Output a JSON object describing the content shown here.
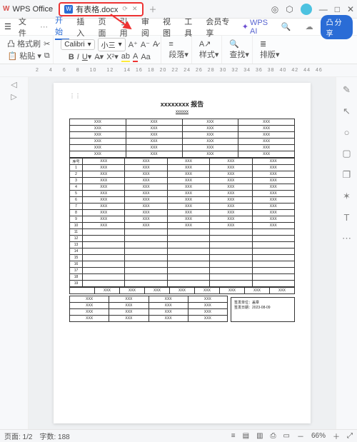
{
  "titlebar": {
    "app_name": "WPS Office",
    "tab_label": "有表格.docx",
    "plus": "＋"
  },
  "menubar": {
    "file_icon": "☰",
    "file": "文件",
    "items": [
      "开始",
      "插入",
      "页面",
      "引用",
      "审阅",
      "视图",
      "工具",
      "会员专享"
    ],
    "ai": "WPS AI",
    "share": "分享"
  },
  "toolbar": {
    "format_brush": "格式刷",
    "paste": "粘贴",
    "font_name": "Calibri",
    "font_size": "小三",
    "paragraph": "段落",
    "styles": "样式",
    "find": "查找",
    "layout": "排版"
  },
  "ruler_marks": [
    "2",
    "",
    "4",
    "",
    "6",
    "",
    "8",
    "",
    "10",
    "",
    "12",
    "",
    "14",
    "16",
    "18",
    "20",
    "22",
    "24",
    "26",
    "28",
    "30",
    "32",
    "34",
    "36",
    "38",
    "40",
    "42",
    "44",
    "46"
  ],
  "document": {
    "title": "xxxxxxxx 报告",
    "subtitle": "xxxxxx",
    "serial_header": "序号",
    "cell": "XXX",
    "signature_unit_label": "签发单位：",
    "signature_unit_value": "盖章",
    "signature_date_label": "签发日期：",
    "signature_date_value": "2023-08-09"
  },
  "statusbar": {
    "page": "页面: 1/2",
    "words": "字数: 188",
    "zoom": "66%"
  },
  "icons": {
    "cloud": "☁",
    "search": "🔍",
    "minimize": "—",
    "maximize": "□",
    "close": "✕",
    "cube": "⬡",
    "target": "◎",
    "pen": "✎",
    "pointer": "↖",
    "circle": "○",
    "square": "▢",
    "layers": "❐",
    "star": "✶",
    "tee": "T",
    "dots": "⋯",
    "menu": "≡",
    "doc": "▤",
    "grid": "▥",
    "printer": "⎙",
    "book": "▭",
    "plus": "＋",
    "minus": "－",
    "expand": "⤢",
    "dd": "▾"
  }
}
